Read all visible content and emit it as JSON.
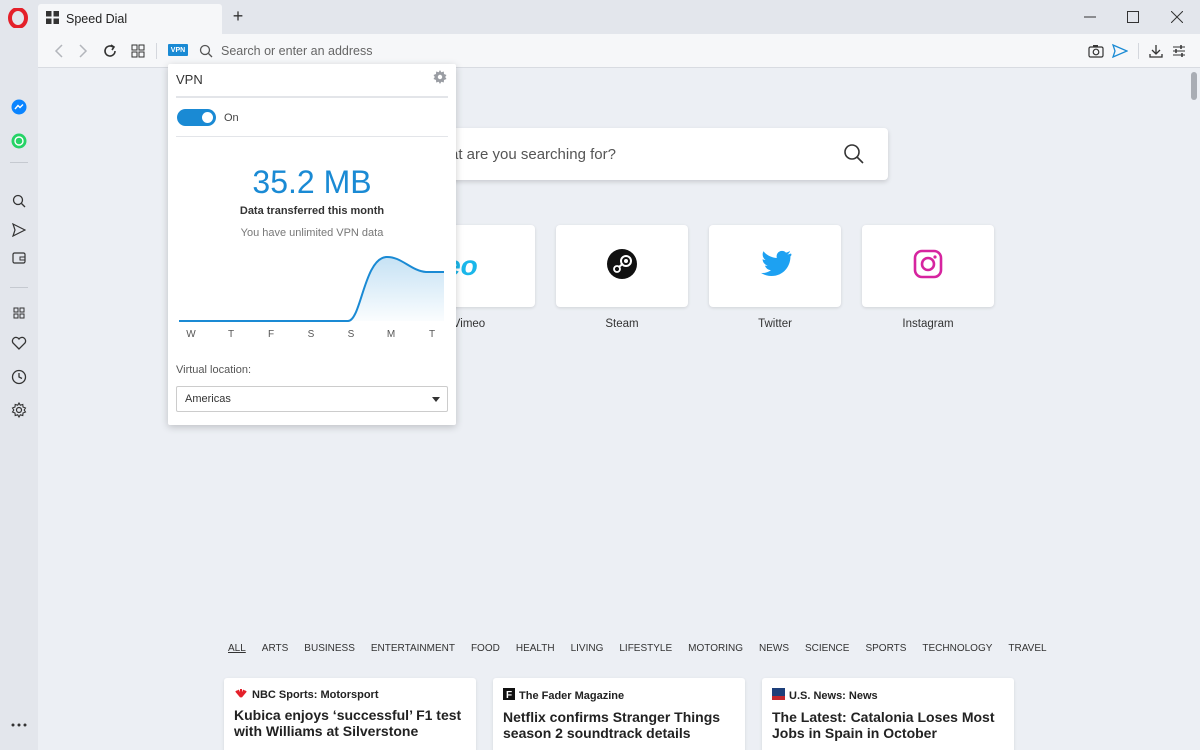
{
  "tab": {
    "title": "Speed Dial",
    "new_tab_label": "+"
  },
  "addressbar": {
    "placeholder": "Search or enter an address",
    "vpn_badge": "VPN"
  },
  "search": {
    "placeholder": "at are you searching for?"
  },
  "speed_dial": [
    {
      "label": "Vimeo",
      "logo_text": "meo",
      "icon": "vimeo-logo",
      "color": "#1ab7ea"
    },
    {
      "label": "Steam",
      "icon": "steam-icon",
      "color": "#111111"
    },
    {
      "label": "Twitter",
      "icon": "twitter-icon",
      "color": "#1da1f2"
    },
    {
      "label": "Instagram",
      "icon": "instagram-icon",
      "color": "#d6249f"
    }
  ],
  "news": {
    "categories": [
      "ALL",
      "ARTS",
      "BUSINESS",
      "ENTERTAINMENT",
      "FOOD",
      "HEALTH",
      "LIVING",
      "LIFESTYLE",
      "MOTORING",
      "NEWS",
      "SCIENCE",
      "SPORTS",
      "TECHNOLOGY",
      "TRAVEL"
    ],
    "active_category": "ALL",
    "cards": [
      {
        "source": "NBC Sports: Motorsport",
        "title": "Kubica enjoys ‘successful’ F1 test with Williams at Silverstone",
        "icon": "nbc-peacock-icon"
      },
      {
        "source": "The Fader Magazine",
        "title": "Netflix confirms Stranger Things season 2 soundtrack details",
        "icon": "fader-f-icon"
      },
      {
        "source": "U.S. News: News",
        "title": "The Latest: Catalonia Loses Most Jobs in Spain in October",
        "icon": "usn-icon"
      }
    ]
  },
  "vpn": {
    "title": "VPN",
    "toggle_label": "On",
    "toggle_on": true,
    "amount": "35.2 MB",
    "amount_caption": "Data transferred this month",
    "unlimited_text": "You have unlimited VPN data",
    "days": [
      "W",
      "T",
      "F",
      "S",
      "S",
      "M",
      "T"
    ],
    "location_label": "Virtual location:",
    "location_value": "Americas"
  },
  "colors": {
    "accent": "#1a8ad4",
    "opera_red": "#e4202a"
  }
}
